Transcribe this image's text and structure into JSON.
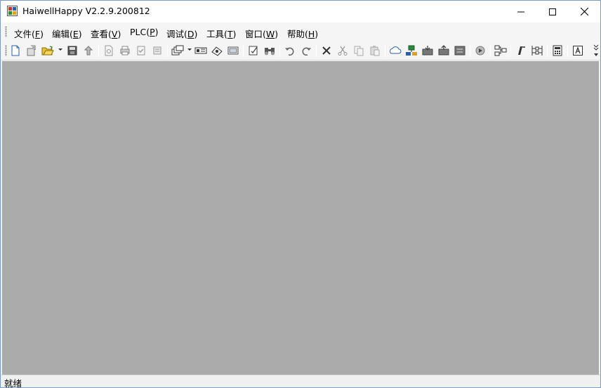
{
  "window": {
    "title": "HaiwellHappy V2.2.9.200812"
  },
  "menu": [
    {
      "label": "文件(",
      "key": "F",
      "close": ")"
    },
    {
      "label": "编辑(",
      "key": "E",
      "close": ")"
    },
    {
      "label": "查看(",
      "key": "V",
      "close": ")"
    },
    {
      "label": "PLC(",
      "key": "P",
      "close": ")"
    },
    {
      "label": "调试(",
      "key": "D",
      "close": ")"
    },
    {
      "label": "工具(",
      "key": "T",
      "close": ")"
    },
    {
      "label": "窗口(",
      "key": "W",
      "close": ")"
    },
    {
      "label": "帮助(",
      "key": "H",
      "close": ")"
    }
  ],
  "toolbar_icons": [
    "new-file-icon",
    "new-project-icon",
    "open-folder-icon",
    "save-icon",
    "upload-icon",
    "print-preview-icon",
    "print-icon",
    "check-icon",
    "properties-icon",
    "windows-icon",
    "plc-module-icon",
    "plc-settings-icon",
    "monitor-icon",
    "edit-check-icon",
    "find-icon",
    "undo-icon",
    "redo-icon",
    "delete-icon",
    "cut-icon",
    "copy-icon",
    "paste-icon",
    "online-icon",
    "network-icon",
    "download-plc-icon",
    "upload-plc-icon",
    "compare-plc-icon",
    "run-icon",
    "flowchart-icon",
    "instruction-icon",
    "ladder-icon",
    "calculator-icon",
    "text-icon"
  ],
  "status": {
    "text": "就绪"
  },
  "colors": {
    "client_bg": "#ababab",
    "toolbar_bg": "#f5f5f5",
    "titlebar_bg": "#ffffff",
    "accent_blue": "#2a5fa8"
  }
}
